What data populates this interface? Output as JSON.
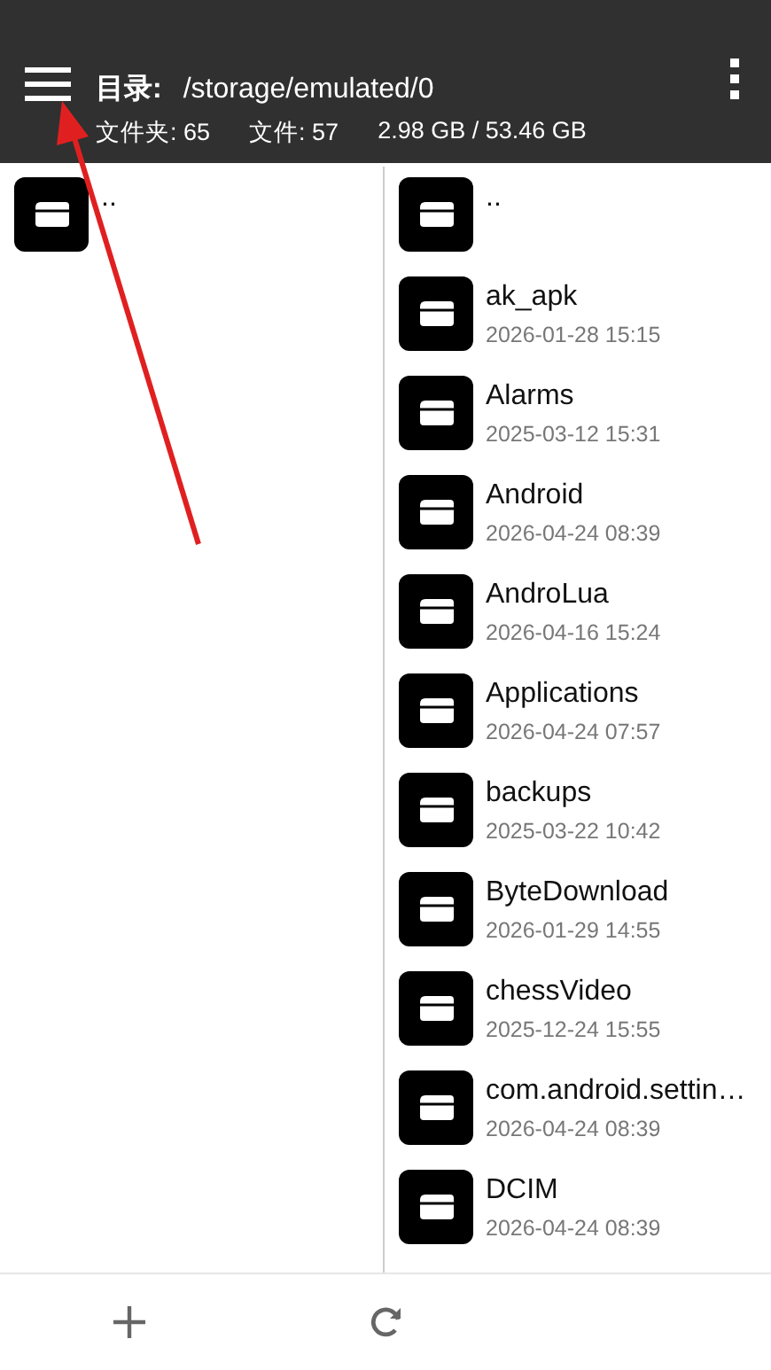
{
  "header": {
    "label": "目录:",
    "path": "/storage/emulated/0",
    "stats": [
      "文件夹: 65",
      "文件: 57",
      "2.98 GB / 53.46 GB"
    ]
  },
  "left_pane": {
    "items": [
      {
        "name": ".."
      }
    ]
  },
  "right_pane": {
    "items": [
      {
        "name": ".."
      },
      {
        "name": "ak_apk",
        "date": "2026-01-28 15:15"
      },
      {
        "name": "Alarms",
        "date": "2025-03-12 15:31"
      },
      {
        "name": "Android",
        "date": "2026-04-24 08:39"
      },
      {
        "name": "AndroLua",
        "date": "2026-04-16 15:24"
      },
      {
        "name": "Applications",
        "date": "2026-04-24 07:57"
      },
      {
        "name": "backups",
        "date": "2025-03-22 10:42"
      },
      {
        "name": "ByteDownload",
        "date": "2026-01-29 14:55"
      },
      {
        "name": "chessVideo",
        "date": "2025-12-24 15:55"
      },
      {
        "name": "com.android.settin…",
        "date": "2026-04-24 08:39"
      },
      {
        "name": "DCIM",
        "date": "2026-04-24 08:39"
      }
    ]
  },
  "toolbar": {
    "buttons": [
      {
        "kind": "add"
      },
      {
        "kind": "refresh"
      }
    ]
  }
}
